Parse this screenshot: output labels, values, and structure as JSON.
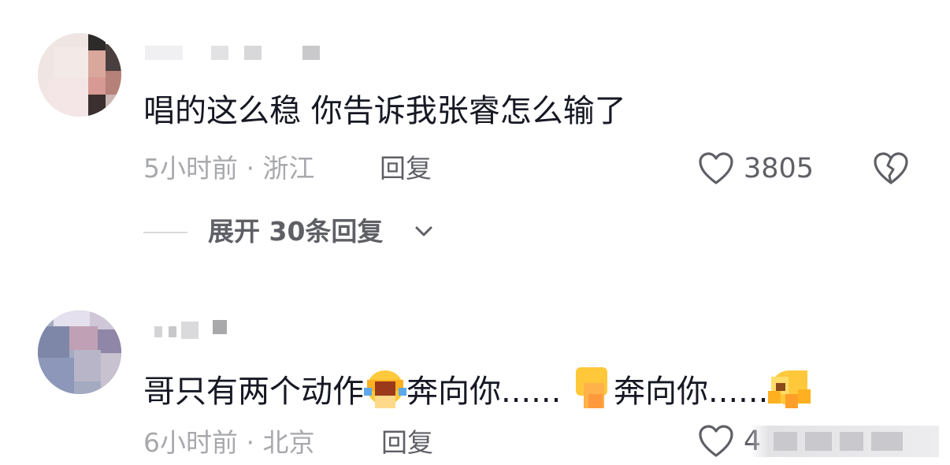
{
  "comments": [
    {
      "text_before": "唱的这么稳 你告诉我张睿怎么输了",
      "meta": "5小时前 · 浙江",
      "reply_label": "回复",
      "likes": "3805",
      "expand_label": "展开 30条回复"
    },
    {
      "text_parts": [
        "哥只有两个动作",
        "奔向你......",
        "奔向你......"
      ],
      "meta": "6小时前 · 北京",
      "reply_label": "回复",
      "likes": "4"
    }
  ],
  "icons": {
    "like": "heart-outline-icon",
    "dislike": "broken-heart-icon",
    "expand": "chevron-down-icon"
  },
  "colors": {
    "text": "#161823",
    "meta": "#a8a9ad",
    "secondary": "#5f6066",
    "emoji": "#ffc93c"
  }
}
